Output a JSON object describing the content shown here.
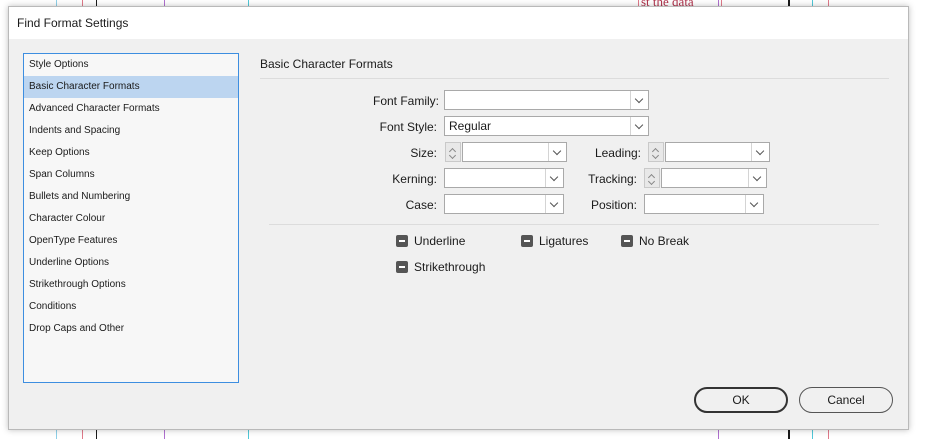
{
  "background": {
    "text_fragment": "st the data"
  },
  "dialog": {
    "title": "Find Format Settings"
  },
  "sidebar": {
    "items": [
      {
        "label": "Style Options",
        "selected": false
      },
      {
        "label": "Basic Character Formats",
        "selected": true
      },
      {
        "label": "Advanced Character Formats",
        "selected": false
      },
      {
        "label": "Indents and Spacing",
        "selected": false
      },
      {
        "label": "Keep Options",
        "selected": false
      },
      {
        "label": "Span Columns",
        "selected": false
      },
      {
        "label": "Bullets and Numbering",
        "selected": false
      },
      {
        "label": "Character Colour",
        "selected": false
      },
      {
        "label": "OpenType Features",
        "selected": false
      },
      {
        "label": "Underline Options",
        "selected": false
      },
      {
        "label": "Strikethrough Options",
        "selected": false
      },
      {
        "label": "Conditions",
        "selected": false
      },
      {
        "label": "Drop Caps and Other",
        "selected": false
      }
    ]
  },
  "panel": {
    "title": "Basic Character Formats",
    "font_family": {
      "label": "Font Family:",
      "value": ""
    },
    "font_style": {
      "label": "Font Style:",
      "value": "Regular"
    },
    "size": {
      "label": "Size:",
      "value": ""
    },
    "leading": {
      "label": "Leading:",
      "value": ""
    },
    "kerning": {
      "label": "Kerning:",
      "value": ""
    },
    "tracking": {
      "label": "Tracking:",
      "value": ""
    },
    "case": {
      "label": "Case:",
      "value": ""
    },
    "position": {
      "label": "Position:",
      "value": ""
    },
    "checkboxes": {
      "underline": "Underline",
      "ligatures": "Ligatures",
      "no_break": "No Break",
      "strikethrough": "Strikethrough"
    }
  },
  "buttons": {
    "ok": "OK",
    "cancel": "Cancel"
  },
  "colors": {
    "selection": "#bcd5f0",
    "list_border": "#3d8ee0",
    "dialog_bg": "#f0f0f0"
  }
}
